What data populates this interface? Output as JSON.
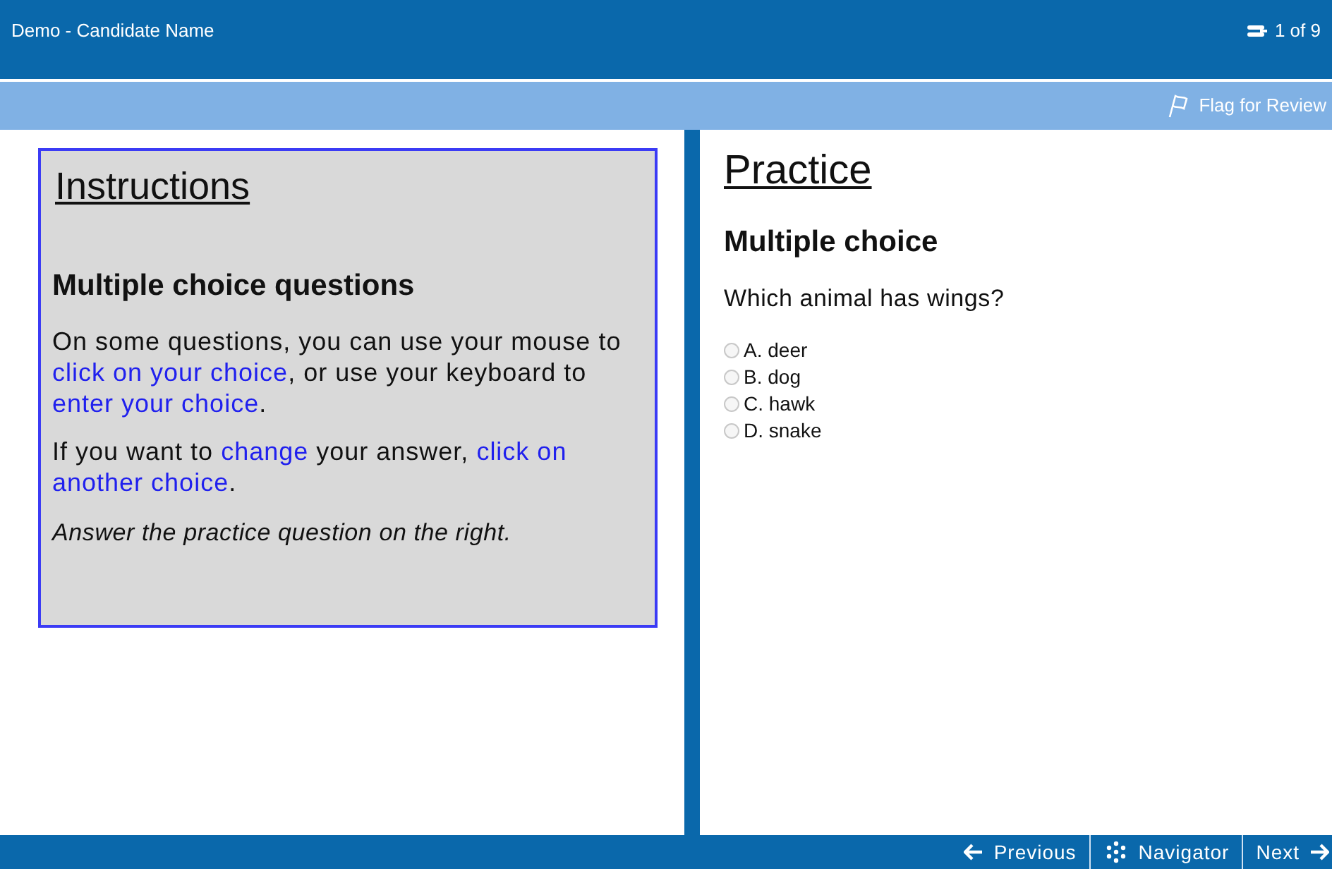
{
  "header": {
    "title": "Demo - Candidate Name",
    "progress": "1 of 9"
  },
  "flag": {
    "label": "Flag for Review",
    "flagged": false
  },
  "instructions": {
    "title": "Instructions",
    "heading": "Multiple choice questions",
    "paragraphs": [
      [
        {
          "text": "On some questions, you can use your mouse to ",
          "highlight": false
        },
        {
          "text": "click on your choice",
          "highlight": true
        },
        {
          "text": ", or use your keyboard to ",
          "highlight": false
        },
        {
          "text": "enter your choice",
          "highlight": true
        },
        {
          "text": ".",
          "highlight": false
        }
      ],
      [
        {
          "text": "If you want to ",
          "highlight": false
        },
        {
          "text": "change",
          "highlight": true
        },
        {
          "text": " your answer, ",
          "highlight": false
        },
        {
          "text": "click on another choice",
          "highlight": true
        },
        {
          "text": ".",
          "highlight": false
        }
      ]
    ],
    "note": "Answer the practice question on the right."
  },
  "question": {
    "title": "Practice",
    "heading": "Multiple choice",
    "prompt": "Which animal has wings?",
    "options": [
      {
        "label": "A. deer",
        "selected": false
      },
      {
        "label": "B. dog",
        "selected": false
      },
      {
        "label": "C. hawk",
        "selected": false
      },
      {
        "label": "D. snake",
        "selected": false
      }
    ]
  },
  "footer": {
    "buttons": [
      {
        "kind": "previous",
        "label": "Previous"
      },
      {
        "kind": "navigator",
        "label": "Navigator"
      },
      {
        "kind": "next",
        "label": "Next"
      }
    ]
  }
}
